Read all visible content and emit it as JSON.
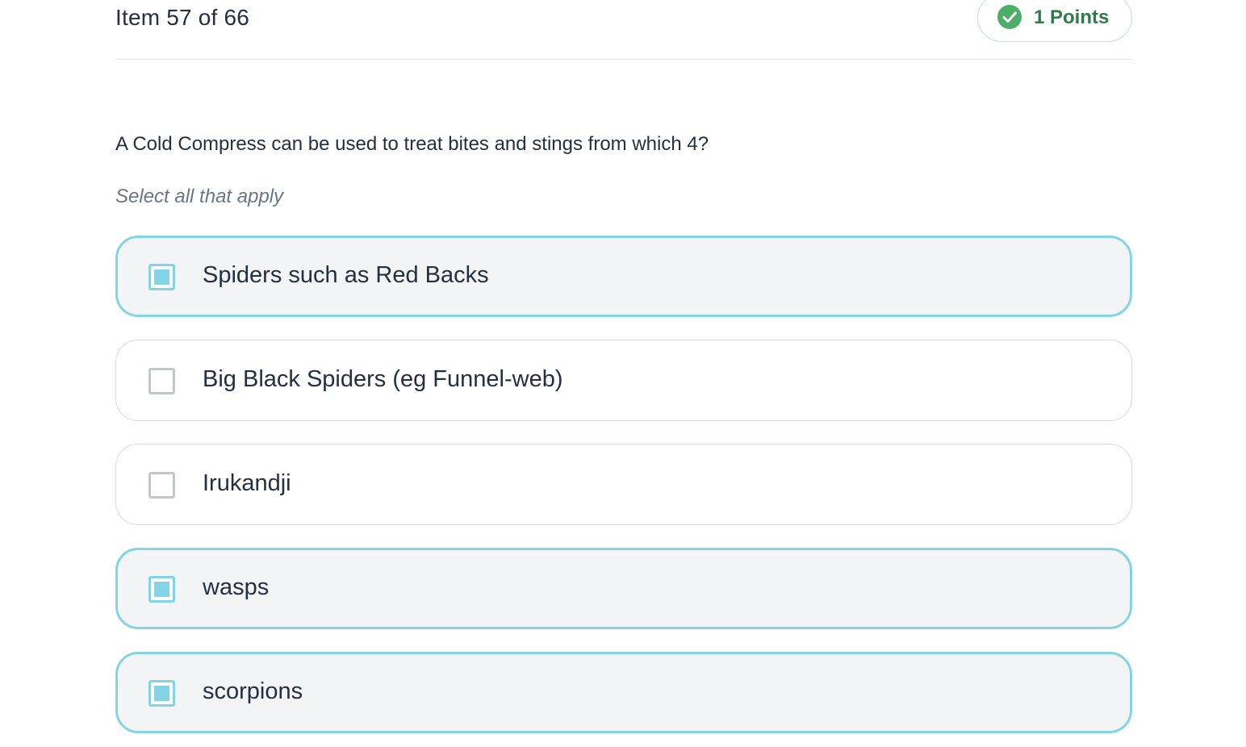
{
  "header": {
    "item_counter": "Item 57 of 66",
    "points_label": "1 Points",
    "points_icon": "check-circle-icon",
    "points_color": "#4caf68"
  },
  "question": {
    "text": "A Cold Compress can be used to treat bites and stings from which 4?",
    "instruction": "Select all that apply"
  },
  "options": [
    {
      "label": "Spiders such as Red Backs",
      "selected": true
    },
    {
      "label": "Big Black Spiders (eg Funnel-web)",
      "selected": false
    },
    {
      "label": "Irukandji",
      "selected": false
    },
    {
      "label": "wasps",
      "selected": true
    },
    {
      "label": "scorpions",
      "selected": true
    }
  ],
  "colors": {
    "selected_accent": "#84d4e8",
    "selected_background": "#f3f4f6",
    "unselected_border": "#d7dbe0"
  }
}
